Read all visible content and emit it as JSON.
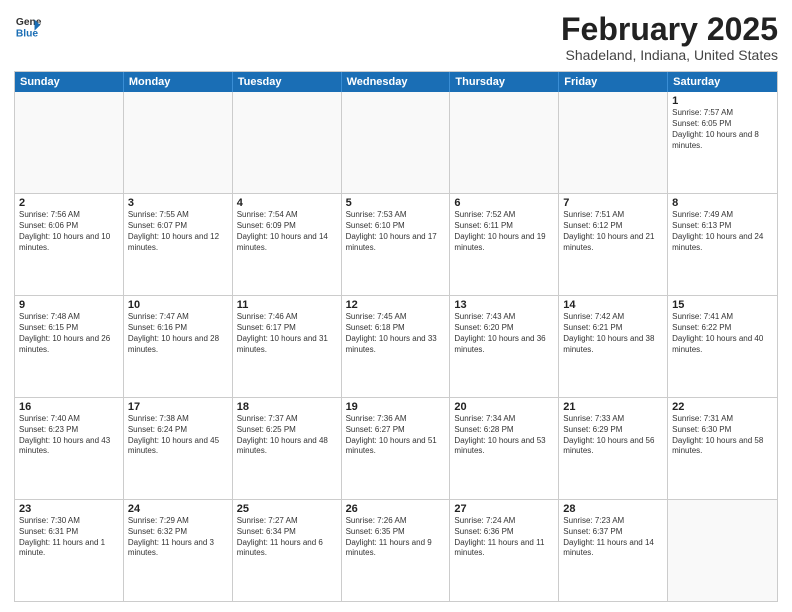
{
  "logo": {
    "line1": "General",
    "line2": "Blue"
  },
  "title": {
    "month_year": "February 2025",
    "location": "Shadeland, Indiana, United States"
  },
  "header_days": [
    "Sunday",
    "Monday",
    "Tuesday",
    "Wednesday",
    "Thursday",
    "Friday",
    "Saturday"
  ],
  "weeks": [
    [
      {
        "day": "",
        "text": ""
      },
      {
        "day": "",
        "text": ""
      },
      {
        "day": "",
        "text": ""
      },
      {
        "day": "",
        "text": ""
      },
      {
        "day": "",
        "text": ""
      },
      {
        "day": "",
        "text": ""
      },
      {
        "day": "1",
        "text": "Sunrise: 7:57 AM\nSunset: 6:05 PM\nDaylight: 10 hours and 8 minutes."
      }
    ],
    [
      {
        "day": "2",
        "text": "Sunrise: 7:56 AM\nSunset: 6:06 PM\nDaylight: 10 hours and 10 minutes."
      },
      {
        "day": "3",
        "text": "Sunrise: 7:55 AM\nSunset: 6:07 PM\nDaylight: 10 hours and 12 minutes."
      },
      {
        "day": "4",
        "text": "Sunrise: 7:54 AM\nSunset: 6:09 PM\nDaylight: 10 hours and 14 minutes."
      },
      {
        "day": "5",
        "text": "Sunrise: 7:53 AM\nSunset: 6:10 PM\nDaylight: 10 hours and 17 minutes."
      },
      {
        "day": "6",
        "text": "Sunrise: 7:52 AM\nSunset: 6:11 PM\nDaylight: 10 hours and 19 minutes."
      },
      {
        "day": "7",
        "text": "Sunrise: 7:51 AM\nSunset: 6:12 PM\nDaylight: 10 hours and 21 minutes."
      },
      {
        "day": "8",
        "text": "Sunrise: 7:49 AM\nSunset: 6:13 PM\nDaylight: 10 hours and 24 minutes."
      }
    ],
    [
      {
        "day": "9",
        "text": "Sunrise: 7:48 AM\nSunset: 6:15 PM\nDaylight: 10 hours and 26 minutes."
      },
      {
        "day": "10",
        "text": "Sunrise: 7:47 AM\nSunset: 6:16 PM\nDaylight: 10 hours and 28 minutes."
      },
      {
        "day": "11",
        "text": "Sunrise: 7:46 AM\nSunset: 6:17 PM\nDaylight: 10 hours and 31 minutes."
      },
      {
        "day": "12",
        "text": "Sunrise: 7:45 AM\nSunset: 6:18 PM\nDaylight: 10 hours and 33 minutes."
      },
      {
        "day": "13",
        "text": "Sunrise: 7:43 AM\nSunset: 6:20 PM\nDaylight: 10 hours and 36 minutes."
      },
      {
        "day": "14",
        "text": "Sunrise: 7:42 AM\nSunset: 6:21 PM\nDaylight: 10 hours and 38 minutes."
      },
      {
        "day": "15",
        "text": "Sunrise: 7:41 AM\nSunset: 6:22 PM\nDaylight: 10 hours and 40 minutes."
      }
    ],
    [
      {
        "day": "16",
        "text": "Sunrise: 7:40 AM\nSunset: 6:23 PM\nDaylight: 10 hours and 43 minutes."
      },
      {
        "day": "17",
        "text": "Sunrise: 7:38 AM\nSunset: 6:24 PM\nDaylight: 10 hours and 45 minutes."
      },
      {
        "day": "18",
        "text": "Sunrise: 7:37 AM\nSunset: 6:25 PM\nDaylight: 10 hours and 48 minutes."
      },
      {
        "day": "19",
        "text": "Sunrise: 7:36 AM\nSunset: 6:27 PM\nDaylight: 10 hours and 51 minutes."
      },
      {
        "day": "20",
        "text": "Sunrise: 7:34 AM\nSunset: 6:28 PM\nDaylight: 10 hours and 53 minutes."
      },
      {
        "day": "21",
        "text": "Sunrise: 7:33 AM\nSunset: 6:29 PM\nDaylight: 10 hours and 56 minutes."
      },
      {
        "day": "22",
        "text": "Sunrise: 7:31 AM\nSunset: 6:30 PM\nDaylight: 10 hours and 58 minutes."
      }
    ],
    [
      {
        "day": "23",
        "text": "Sunrise: 7:30 AM\nSunset: 6:31 PM\nDaylight: 11 hours and 1 minute."
      },
      {
        "day": "24",
        "text": "Sunrise: 7:29 AM\nSunset: 6:32 PM\nDaylight: 11 hours and 3 minutes."
      },
      {
        "day": "25",
        "text": "Sunrise: 7:27 AM\nSunset: 6:34 PM\nDaylight: 11 hours and 6 minutes."
      },
      {
        "day": "26",
        "text": "Sunrise: 7:26 AM\nSunset: 6:35 PM\nDaylight: 11 hours and 9 minutes."
      },
      {
        "day": "27",
        "text": "Sunrise: 7:24 AM\nSunset: 6:36 PM\nDaylight: 11 hours and 11 minutes."
      },
      {
        "day": "28",
        "text": "Sunrise: 7:23 AM\nSunset: 6:37 PM\nDaylight: 11 hours and 14 minutes."
      },
      {
        "day": "",
        "text": ""
      }
    ]
  ]
}
